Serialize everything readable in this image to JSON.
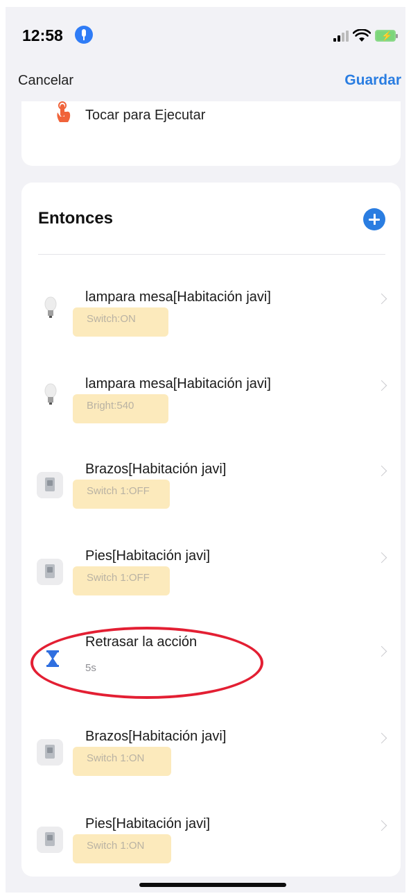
{
  "status_bar": {
    "time": "12:58"
  },
  "nav": {
    "cancel_label": "Cancelar",
    "save_label": "Guardar"
  },
  "trigger": {
    "label": "Tocar para Ejecutar"
  },
  "then_section": {
    "title": "Entonces",
    "items": [
      {
        "title": "lampara mesa[Habitación javi]",
        "subtitle": "Switch:ON",
        "icon": "bulb-icon"
      },
      {
        "title": "lampara mesa[Habitación javi]",
        "subtitle": "Bright:540",
        "icon": "bulb-icon"
      },
      {
        "title": "Brazos[Habitación javi]",
        "subtitle": "Switch 1:OFF",
        "icon": "smart-plug-icon"
      },
      {
        "title": "Pies[Habitación javi]",
        "subtitle": "Switch 1:OFF",
        "icon": "smart-plug-icon"
      },
      {
        "title": "Retrasar la acción",
        "subtitle": "5s",
        "icon": "hourglass-icon"
      },
      {
        "title": "Brazos[Habitación javi]",
        "subtitle": "Switch 1:ON",
        "icon": "smart-plug-icon"
      },
      {
        "title": "Pies[Habitación javi]",
        "subtitle": "Switch 1:ON",
        "icon": "smart-plug-icon"
      }
    ]
  },
  "colors": {
    "accent": "#2a7de1",
    "highlight": "#fbe6b0",
    "annotation": "#e31f33",
    "background": "#f2f2f6"
  }
}
